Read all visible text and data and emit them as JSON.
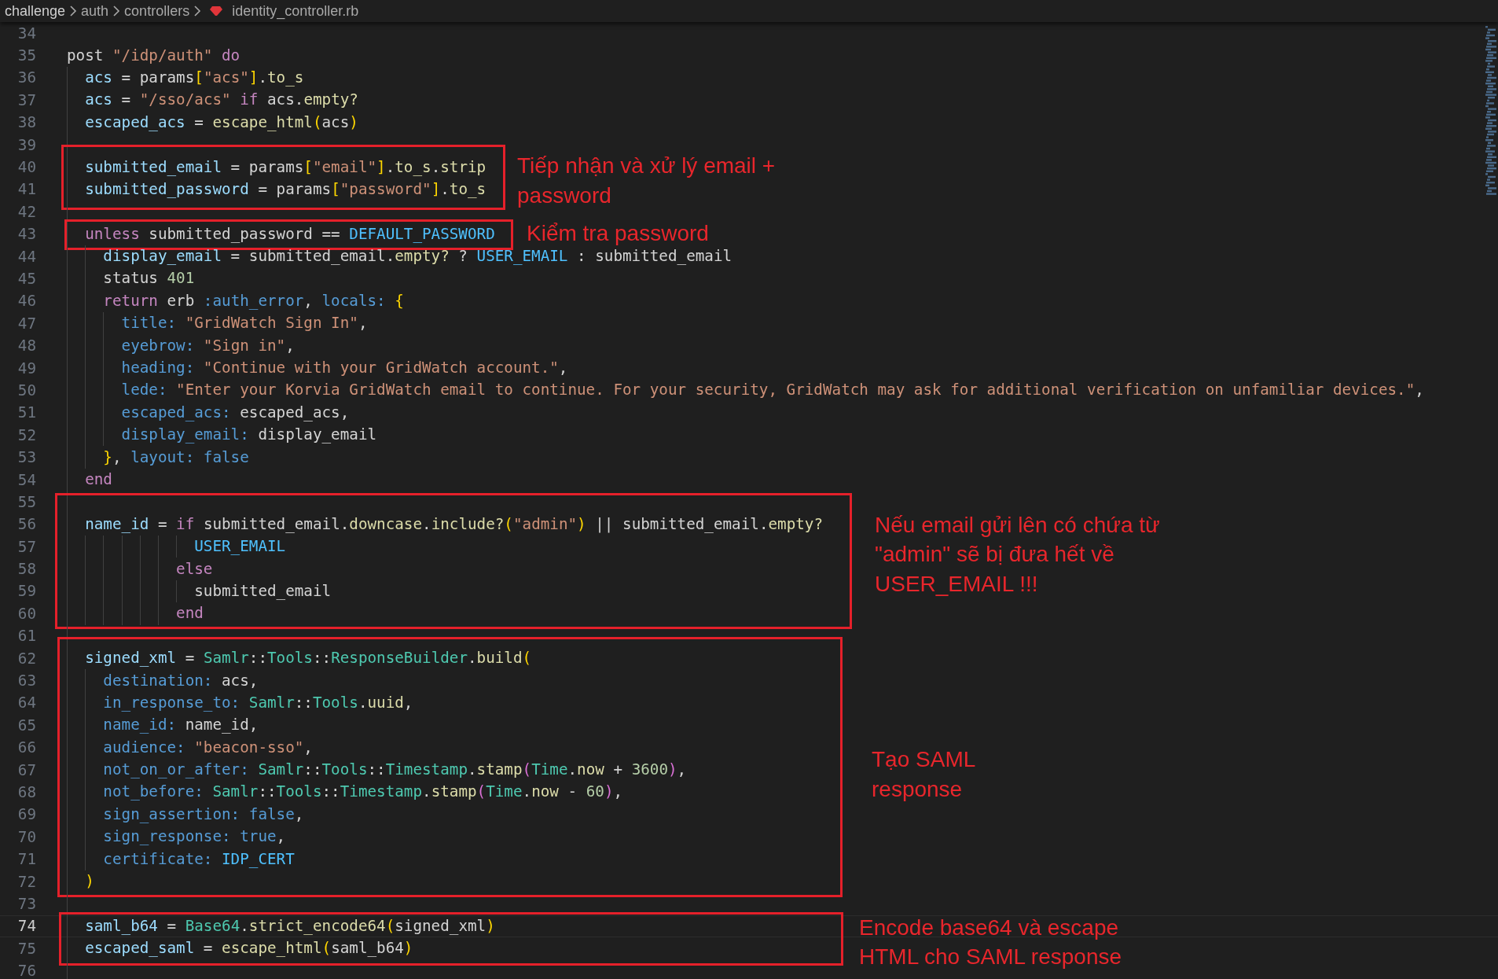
{
  "breadcrumb": {
    "folders": [
      "challenge",
      "auth",
      "controllers"
    ],
    "file": "identity_controller.rb"
  },
  "blocks": [
    {
      "lines": [
        {
          "n": "34",
          "current": false
        },
        {
          "n": "35",
          "current": false,
          "code": [
            {
              "kind": "plain",
              "text": "post "
            },
            {
              "kind": "str",
              "text": "\"/idp/auth\" "
            },
            {
              "kind": "kw",
              "text": "do"
            }
          ]
        },
        {
          "n": "36",
          "current": false,
          "code": [
            {
              "kind": "var",
              "text": "  acs"
            },
            {
              "kind": "plain",
              "text": " = params"
            },
            {
              "kind": "b1",
              "text": "["
            },
            {
              "kind": "str",
              "text": "\"acs\""
            },
            {
              "kind": "b1",
              "text": "]"
            },
            {
              "kind": "plain",
              "text": "."
            },
            {
              "kind": "fn",
              "text": "to_s"
            }
          ]
        },
        {
          "n": "37",
          "current": false,
          "code": [
            {
              "kind": "var",
              "text": "  acs"
            },
            {
              "kind": "plain",
              "text": " = "
            },
            {
              "kind": "str",
              "text": "\"/sso/acs\" "
            },
            {
              "kind": "kw",
              "text": "if"
            },
            {
              "kind": "plain",
              "text": " acs."
            },
            {
              "kind": "fn",
              "text": "empty?"
            }
          ]
        },
        {
          "n": "38",
          "current": false,
          "code": [
            {
              "kind": "var",
              "text": "  escaped_acs"
            },
            {
              "kind": "plain",
              "text": " = "
            },
            {
              "kind": "fn",
              "text": "escape_html"
            },
            {
              "kind": "b1",
              "text": "("
            },
            {
              "kind": "plain",
              "text": "acs"
            },
            {
              "kind": "b1",
              "text": ")"
            }
          ]
        },
        {
          "n": "39",
          "current": false
        }
      ]
    },
    {
      "annotation": {
        "note": [
          "Tiếp nhận và xử lý email +",
          "password"
        ]
      },
      "lines": [
        {
          "n": "40",
          "current": false,
          "code": [
            {
              "kind": "var",
              "text": "  submitted_email"
            },
            {
              "kind": "plain",
              "text": " = params"
            },
            {
              "kind": "b1",
              "text": "["
            },
            {
              "kind": "str",
              "text": "\"email\""
            },
            {
              "kind": "b1",
              "text": "]"
            },
            {
              "kind": "plain",
              "text": "."
            },
            {
              "kind": "fn",
              "text": "to_s"
            },
            {
              "kind": "plain",
              "text": "."
            },
            {
              "kind": "fn",
              "text": "strip"
            }
          ]
        },
        {
          "n": "41",
          "current": false,
          "code": [
            {
              "kind": "var",
              "text": "  submitted_password"
            },
            {
              "kind": "plain",
              "text": " = params"
            },
            {
              "kind": "b1",
              "text": "["
            },
            {
              "kind": "str",
              "text": "\"password\""
            },
            {
              "kind": "b1",
              "text": "]"
            },
            {
              "kind": "plain",
              "text": "."
            },
            {
              "kind": "fn",
              "text": "to_s"
            }
          ]
        }
      ]
    },
    {
      "lines": [
        {
          "n": "42",
          "current": false
        }
      ]
    },
    {
      "annotation": {
        "note": [
          "Kiểm tra password"
        ]
      },
      "lines": [
        {
          "n": "43",
          "current": false,
          "code": [
            {
              "kind": "kw",
              "text": "  unless"
            },
            {
              "kind": "plain",
              "text": " submitted_password == "
            },
            {
              "kind": "const",
              "text": "DEFAULT_PASSWORD"
            }
          ]
        }
      ]
    },
    {
      "lines": [
        {
          "n": "44",
          "current": false,
          "code": [
            {
              "kind": "var",
              "text": "    display_email"
            },
            {
              "kind": "plain",
              "text": " = submitted_email."
            },
            {
              "kind": "fn",
              "text": "empty?"
            },
            {
              "kind": "plain",
              "text": " ? "
            },
            {
              "kind": "const",
              "text": "USER_EMAIL"
            },
            {
              "kind": "plain",
              "text": " : submitted_email"
            }
          ]
        },
        {
          "n": "45",
          "current": false,
          "code": [
            {
              "kind": "plain",
              "text": "    status "
            },
            {
              "kind": "num",
              "text": "401"
            }
          ]
        },
        {
          "n": "46",
          "current": false,
          "code": [
            {
              "kind": "kw",
              "text": "    return"
            },
            {
              "kind": "plain",
              "text": " erb "
            },
            {
              "kind": "sym",
              "text": ":auth_error"
            },
            {
              "kind": "plain",
              "text": ", "
            },
            {
              "kind": "key",
              "text": "locals: "
            },
            {
              "kind": "b1",
              "text": "{"
            }
          ]
        },
        {
          "n": "47",
          "current": false,
          "code": [
            {
              "kind": "key",
              "text": "      title: "
            },
            {
              "kind": "str",
              "text": "\"GridWatch Sign In\""
            },
            {
              "kind": "plain",
              "text": ","
            }
          ]
        },
        {
          "n": "48",
          "current": false,
          "code": [
            {
              "kind": "key",
              "text": "      eyebrow: "
            },
            {
              "kind": "str",
              "text": "\"Sign in\""
            },
            {
              "kind": "plain",
              "text": ","
            }
          ]
        },
        {
          "n": "49",
          "current": false,
          "code": [
            {
              "kind": "key",
              "text": "      heading: "
            },
            {
              "kind": "str",
              "text": "\"Continue with your GridWatch account.\""
            },
            {
              "kind": "plain",
              "text": ","
            }
          ]
        },
        {
          "n": "50",
          "current": false,
          "code": [
            {
              "kind": "key",
              "text": "      lede: "
            },
            {
              "kind": "str",
              "text": "\"Enter your Korvia GridWatch email to continue. For your security, GridWatch may ask for additional verification on unfamiliar devices.\""
            },
            {
              "kind": "plain",
              "text": ","
            }
          ]
        },
        {
          "n": "51",
          "current": false,
          "code": [
            {
              "kind": "key",
              "text": "      escaped_acs:"
            },
            {
              "kind": "plain",
              "text": " escaped_acs,"
            }
          ]
        },
        {
          "n": "52",
          "current": false,
          "code": [
            {
              "kind": "key",
              "text": "      display_email:"
            },
            {
              "kind": "plain",
              "text": " display_email"
            }
          ]
        },
        {
          "n": "53",
          "current": false,
          "code": [
            {
              "kind": "b1",
              "text": "    }"
            },
            {
              "kind": "plain",
              "text": ", "
            },
            {
              "kind": "key",
              "text": "layout: false"
            }
          ]
        },
        {
          "n": "54",
          "current": false,
          "code": [
            {
              "kind": "kw",
              "text": "  end"
            }
          ]
        },
        {
          "n": "55",
          "current": false
        }
      ]
    },
    {
      "annotation": {
        "note": [
          "Nếu email gửi lên có chứa từ",
          "\"admin\" sẽ bị đưa hết về",
          "USER_EMAIL !!!"
        ]
      },
      "lines": [
        {
          "n": "56",
          "current": false,
          "code": [
            {
              "kind": "var",
              "text": "  name_id"
            },
            {
              "kind": "plain",
              "text": " = "
            },
            {
              "kind": "kw",
              "text": "if"
            },
            {
              "kind": "plain",
              "text": " submitted_email."
            },
            {
              "kind": "fn",
              "text": "downcase"
            },
            {
              "kind": "plain",
              "text": "."
            },
            {
              "kind": "fn",
              "text": "include?"
            },
            {
              "kind": "b1",
              "text": "("
            },
            {
              "kind": "str",
              "text": "\"admin\""
            },
            {
              "kind": "b1",
              "text": ")"
            },
            {
              "kind": "plain",
              "text": " || submitted_email."
            },
            {
              "kind": "fn",
              "text": "empty?"
            }
          ]
        },
        {
          "n": "57",
          "current": false,
          "code": [
            {
              "kind": "const",
              "text": "              USER_EMAIL"
            }
          ]
        },
        {
          "n": "58",
          "current": false,
          "code": [
            {
              "kind": "kw",
              "text": "            else"
            }
          ]
        },
        {
          "n": "59",
          "current": false,
          "code": [
            {
              "kind": "plain",
              "text": "              submitted_email"
            }
          ]
        },
        {
          "n": "60",
          "current": false,
          "code": [
            {
              "kind": "kw",
              "text": "            end"
            }
          ]
        }
      ]
    },
    {
      "lines": [
        {
          "n": "61",
          "current": false
        }
      ]
    },
    {
      "annotation": {
        "note": [
          "Tạo SAML",
          "response"
        ]
      },
      "lines": [
        {
          "n": "62",
          "current": false,
          "code": [
            {
              "kind": "var",
              "text": "  signed_xml"
            },
            {
              "kind": "plain",
              "text": " = "
            },
            {
              "kind": "cls",
              "text": "Samlr"
            },
            {
              "kind": "plain",
              "text": "::"
            },
            {
              "kind": "cls",
              "text": "Tools"
            },
            {
              "kind": "plain",
              "text": "::"
            },
            {
              "kind": "cls",
              "text": "ResponseBuilder"
            },
            {
              "kind": "plain",
              "text": "."
            },
            {
              "kind": "fn",
              "text": "build"
            },
            {
              "kind": "b1",
              "text": "("
            }
          ]
        },
        {
          "n": "63",
          "current": false,
          "code": [
            {
              "kind": "key",
              "text": "    destination:"
            },
            {
              "kind": "plain",
              "text": " acs,"
            }
          ]
        },
        {
          "n": "64",
          "current": false,
          "code": [
            {
              "kind": "key",
              "text": "    in_response_to: "
            },
            {
              "kind": "cls",
              "text": "Samlr"
            },
            {
              "kind": "plain",
              "text": "::"
            },
            {
              "kind": "cls",
              "text": "Tools"
            },
            {
              "kind": "plain",
              "text": "."
            },
            {
              "kind": "fn",
              "text": "uuid"
            },
            {
              "kind": "plain",
              "text": ","
            }
          ]
        },
        {
          "n": "65",
          "current": false,
          "code": [
            {
              "kind": "key",
              "text": "    name_id:"
            },
            {
              "kind": "plain",
              "text": " name_id,"
            }
          ]
        },
        {
          "n": "66",
          "current": false,
          "code": [
            {
              "kind": "key",
              "text": "    audience: "
            },
            {
              "kind": "str",
              "text": "\"beacon-sso\""
            },
            {
              "kind": "plain",
              "text": ","
            }
          ]
        },
        {
          "n": "67",
          "current": false,
          "code": [
            {
              "kind": "key",
              "text": "    not_on_or_after: "
            },
            {
              "kind": "cls",
              "text": "Samlr"
            },
            {
              "kind": "plain",
              "text": "::"
            },
            {
              "kind": "cls",
              "text": "Tools"
            },
            {
              "kind": "plain",
              "text": "::"
            },
            {
              "kind": "cls",
              "text": "Timestamp"
            },
            {
              "kind": "plain",
              "text": "."
            },
            {
              "kind": "fn",
              "text": "stamp"
            },
            {
              "kind": "b2",
              "text": "("
            },
            {
              "kind": "cls",
              "text": "Time"
            },
            {
              "kind": "plain",
              "text": "."
            },
            {
              "kind": "fn",
              "text": "now"
            },
            {
              "kind": "plain",
              "text": " + "
            },
            {
              "kind": "num",
              "text": "3600"
            },
            {
              "kind": "b2",
              "text": ")"
            },
            {
              "kind": "plain",
              "text": ","
            }
          ]
        },
        {
          "n": "68",
          "current": false,
          "code": [
            {
              "kind": "key",
              "text": "    not_before: "
            },
            {
              "kind": "cls",
              "text": "Samlr"
            },
            {
              "kind": "plain",
              "text": "::"
            },
            {
              "kind": "cls",
              "text": "Tools"
            },
            {
              "kind": "plain",
              "text": "::"
            },
            {
              "kind": "cls",
              "text": "Timestamp"
            },
            {
              "kind": "plain",
              "text": "."
            },
            {
              "kind": "fn",
              "text": "stamp"
            },
            {
              "kind": "b2",
              "text": "("
            },
            {
              "kind": "cls",
              "text": "Time"
            },
            {
              "kind": "plain",
              "text": "."
            },
            {
              "kind": "fn",
              "text": "now"
            },
            {
              "kind": "plain",
              "text": " - "
            },
            {
              "kind": "num",
              "text": "60"
            },
            {
              "kind": "b2",
              "text": ")"
            },
            {
              "kind": "plain",
              "text": ","
            }
          ]
        },
        {
          "n": "69",
          "current": false,
          "code": [
            {
              "kind": "key",
              "text": "    sign_assertion: false"
            },
            {
              "kind": "plain",
              "text": ","
            }
          ]
        },
        {
          "n": "70",
          "current": false,
          "code": [
            {
              "kind": "key",
              "text": "    sign_response: true"
            },
            {
              "kind": "plain",
              "text": ","
            }
          ]
        },
        {
          "n": "71",
          "current": false,
          "code": [
            {
              "kind": "key",
              "text": "    certificate: "
            },
            {
              "kind": "const",
              "text": "IDP_CERT"
            }
          ]
        },
        {
          "n": "72",
          "current": false,
          "code": [
            {
              "kind": "b1",
              "text": "  )"
            }
          ]
        }
      ]
    },
    {
      "lines": [
        {
          "n": "73",
          "current": false
        }
      ]
    },
    {
      "annotation": {
        "note": [
          "Encode base64 và escape",
          "HTML cho SAML response"
        ]
      },
      "lines": [
        {
          "n": "74",
          "current": true,
          "code": [
            {
              "kind": "var",
              "text": "  saml_b64"
            },
            {
              "kind": "plain",
              "text": " = "
            },
            {
              "kind": "cls",
              "text": "Base64"
            },
            {
              "kind": "plain",
              "text": "."
            },
            {
              "kind": "fn",
              "text": "strict_encode64"
            },
            {
              "kind": "b1",
              "text": "("
            },
            {
              "kind": "plain",
              "text": "signed_xml"
            },
            {
              "kind": "b1",
              "text": ")"
            }
          ]
        },
        {
          "n": "75",
          "current": false,
          "code": [
            {
              "kind": "var",
              "text": "  escaped_saml"
            },
            {
              "kind": "plain",
              "text": " = "
            },
            {
              "kind": "fn",
              "text": "escape_html"
            },
            {
              "kind": "b1",
              "text": "("
            },
            {
              "kind": "plain",
              "text": "saml_b64"
            },
            {
              "kind": "b1",
              "text": ")"
            }
          ]
        }
      ]
    },
    {
      "lines": [
        {
          "n": "76",
          "current": false
        }
      ]
    }
  ]
}
